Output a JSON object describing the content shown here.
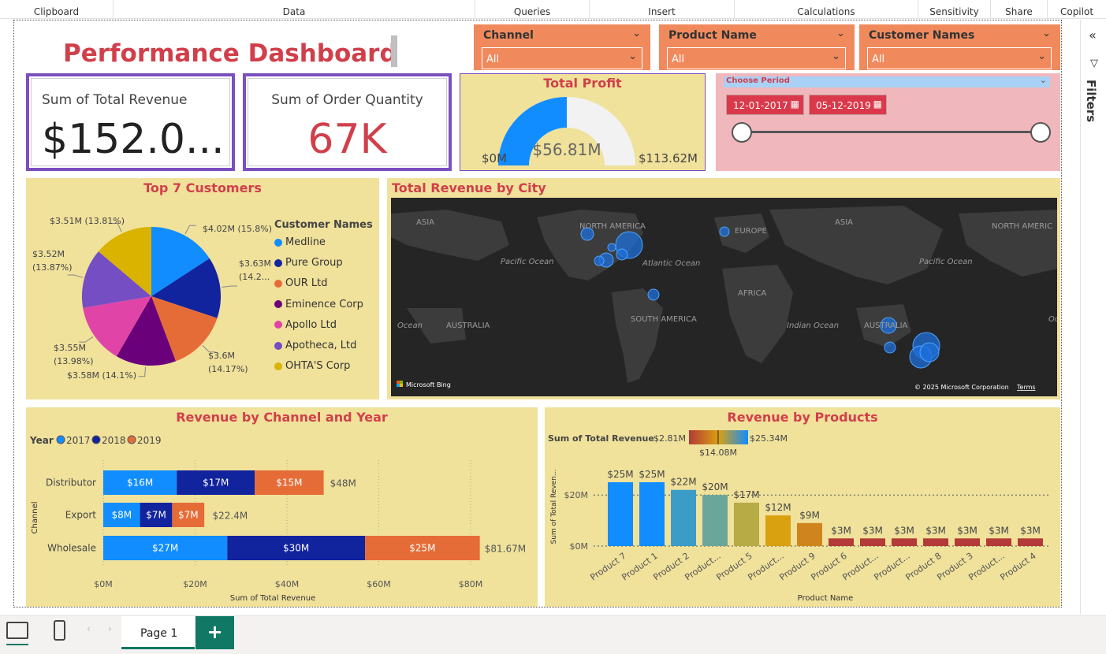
{
  "ribbon": [
    {
      "label": "Clipboard"
    },
    {
      "label": "Data"
    },
    {
      "label": "Queries"
    },
    {
      "label": "Insert"
    },
    {
      "label": "Calculations"
    },
    {
      "label": "Sensitivity"
    },
    {
      "label": "Share"
    },
    {
      "label": "Copilot"
    }
  ],
  "header": {
    "title": "Performance Dashboard"
  },
  "slicers": {
    "channel": {
      "label": "Channel",
      "value": "All"
    },
    "product": {
      "label": "Product Name",
      "value": "All"
    },
    "customer": {
      "label": "Customer Names",
      "value": "All"
    }
  },
  "kpis": {
    "revenue": {
      "caption": "Sum of Total Revenue",
      "value": "$152.0..."
    },
    "quantity": {
      "caption": "Sum of Order Quantity",
      "value": "67K"
    }
  },
  "gauge": {
    "title": "Total Profit",
    "min": "$0M",
    "max": "$113.62M",
    "value_label": "$56.81M",
    "value": 56.81,
    "max_value": 113.62
  },
  "period": {
    "label": "Choose Period",
    "start": "12-01-2017",
    "end": "05-12-2019"
  },
  "customers": {
    "title": "Top 7 Customers",
    "legend_title": "Customer Names",
    "items": [
      {
        "name": "Medline",
        "value": 4.02,
        "label": "$4.02M (15.8%)",
        "color": "#118dff"
      },
      {
        "name": "Pure Group",
        "value": 3.63,
        "label": "$3.63M (14.2...",
        "color": "#12239e"
      },
      {
        "name": "OUR Ltd",
        "value": 3.6,
        "label": "$3.6M (14.17%)",
        "color": "#e66c37"
      },
      {
        "name": "Eminence Corp",
        "value": 3.58,
        "label": "$3.58M (14.1%)",
        "color": "#6b007b"
      },
      {
        "name": "Apollo Ltd",
        "value": 3.55,
        "label": "$3.55M (13.98%)",
        "color": "#e044a7"
      },
      {
        "name": "Apotheca, Ltd",
        "value": 3.52,
        "label": "$3.52M (13.87%)",
        "color": "#744ec2"
      },
      {
        "name": "OHTA'S Corp",
        "value": 3.51,
        "label": "$3.51M (13.81%)",
        "color": "#d9b300"
      }
    ]
  },
  "map": {
    "title": "Total Revenue by City",
    "labels": [
      "ASIA",
      "NORTH AMERICA",
      "EUROPE",
      "ASIA",
      "NORTH AMERIC",
      "Pacific Ocean",
      "Atlantic Ocean",
      "Pacific Ocean",
      "AFRICA",
      "Ocean",
      "AUSTRALIA",
      "SOUTH AMERICA",
      "Indian Ocean",
      "AUSTRALIA",
      "Oc"
    ],
    "brand": "Microsoft Bing",
    "copyright": "© 2025 Microsoft Corporation",
    "terms": "Terms"
  },
  "channel_chart": {
    "title": "Revenue by Channel and Year",
    "legend_title": "Year",
    "xlabel": "Sum of Total Revenue",
    "ylabel": "Channel"
  },
  "chart_data": [
    {
      "type": "bar",
      "title": "Revenue by Channel and Year",
      "orientation": "horizontal",
      "stacked": true,
      "categories": [
        "Distributor",
        "Export",
        "Wholesale"
      ],
      "series": [
        {
          "name": "2017",
          "values": [
            16,
            8,
            27
          ],
          "labels": [
            "$16M",
            "$8M",
            "$27M"
          ],
          "color": "#118dff"
        },
        {
          "name": "2018",
          "values": [
            17,
            7,
            30
          ],
          "labels": [
            "$17M",
            "$7M",
            "$30M"
          ],
          "color": "#12239e"
        },
        {
          "name": "2019",
          "values": [
            15,
            7,
            25
          ],
          "labels": [
            "$15M",
            "$7M",
            "$25M"
          ],
          "color": "#e66c37"
        }
      ],
      "totals": [
        "$48M",
        "$22.4M",
        "$81.67M"
      ],
      "total_values": [
        48,
        22.4,
        81.67
      ],
      "xticks": [
        "$0M",
        "$20M",
        "$40M",
        "$60M",
        "$80M"
      ],
      "xlim": [
        0,
        85
      ],
      "xlabel": "Sum of Total Revenue",
      "ylabel": "Channel",
      "grid": true,
      "legend": "top-left"
    },
    {
      "type": "bar",
      "title": "Revenue by Products",
      "categories": [
        "Product 7",
        "Product 1",
        "Product 2",
        "Product...",
        "Product 5",
        "Product...",
        "Product 9",
        "Product 6",
        "Product...",
        "Product...",
        "Product 8",
        "Product 3",
        "Product...",
        "Product 4"
      ],
      "values": [
        25,
        25,
        22,
        20,
        17,
        12,
        9,
        3,
        3,
        3,
        3,
        3,
        3,
        3
      ],
      "labels": [
        "$25M",
        "$25M",
        "$22M",
        "$20M",
        "$17M",
        "$12M",
        "$9M",
        "$3M",
        "$3M",
        "$3M",
        "$3M",
        "$3M",
        "$3M",
        "$3M"
      ],
      "colors": [
        "#118dff",
        "#118dff",
        "#3b9cc8",
        "#6aa69a",
        "#b6ac45",
        "#d9a010",
        "#cf841d",
        "#b33a38",
        "#b33a38",
        "#b33a38",
        "#b33a38",
        "#b33a38",
        "#b33a38",
        "#b33a38"
      ],
      "xlabel": "Product Name",
      "ylabel": "Sum of Total Reven...",
      "yticks": [
        "$0M",
        "$20M"
      ],
      "ylim": [
        0,
        30
      ],
      "color_legend": {
        "title": "Sum of Total Revenue",
        "min": "$2.81M",
        "mid": "$14.08M",
        "max": "$25.34M"
      }
    }
  ],
  "products_chart": {
    "title": "Revenue by Products"
  },
  "filters": {
    "label": "Filters"
  },
  "bottom": {
    "page_tab": "Page 1",
    "add": "+"
  }
}
